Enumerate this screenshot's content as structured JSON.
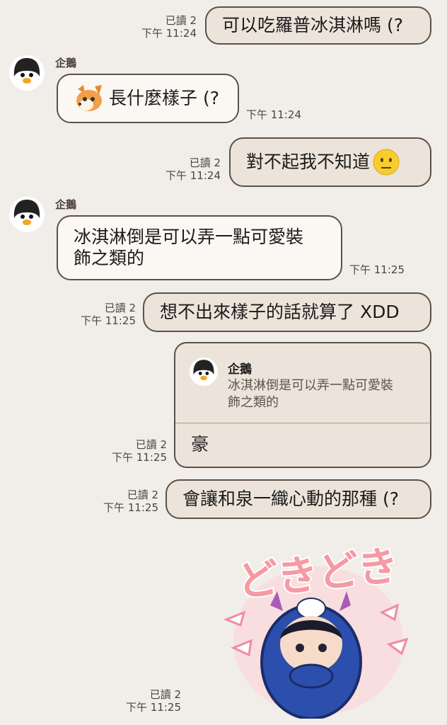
{
  "messages": [
    {
      "id": "m1",
      "side": "out",
      "read": "已讀 2",
      "time": "下午 11:24",
      "text": "可以吃羅普冰淇淋嗎 (?"
    },
    {
      "id": "m2",
      "side": "in",
      "sender": "企鵝",
      "time": "下午 11:24",
      "text": "長什麼樣子 (?",
      "sticker_icon": "fox-emoji-icon"
    },
    {
      "id": "m3",
      "side": "out",
      "read": "已讀 2",
      "time": "下午 11:24",
      "text": "對不起我不知道",
      "emoji": "neutral-face-emoji-icon"
    },
    {
      "id": "m4",
      "side": "in",
      "sender": "企鵝",
      "time": "下午 11:25",
      "text_line1": "冰淇淋倒是可以弄一點可愛裝",
      "text_line2": "飾之類的"
    },
    {
      "id": "m5",
      "side": "out",
      "read": "已讀 2",
      "time": "下午 11:25",
      "text": "想不出來樣子的話就算了 XDD"
    },
    {
      "id": "m6",
      "side": "out",
      "read": "已讀 2",
      "time": "下午 11:25",
      "reply": {
        "sender": "企鵝",
        "line1": "冰淇淋倒是可以弄一點可愛裝",
        "line2": "飾之類的"
      },
      "text": "豪"
    },
    {
      "id": "m7",
      "side": "out",
      "read": "已讀 2",
      "time": "下午 11:25",
      "text": "會讓和泉一織心動的那種 (?"
    },
    {
      "id": "m8",
      "side": "out",
      "read": "已讀 2",
      "time": "下午 11:25",
      "sticker_text": "どきどき",
      "sticker_icon": "blue-hooded-character-sticker"
    }
  ],
  "colors": {
    "background": "#f1ede8",
    "bubble_out": "#ece4da",
    "bubble_in": "#fbf8f4",
    "border": "#5b5149"
  }
}
